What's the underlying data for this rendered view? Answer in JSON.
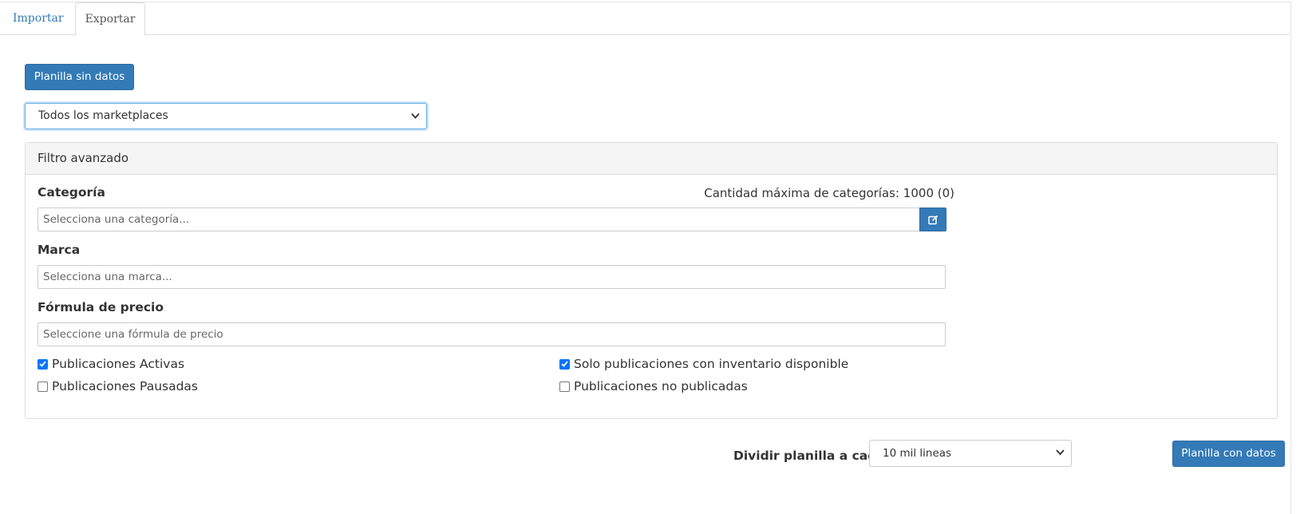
{
  "tabs": [
    {
      "label": "Importar",
      "active": false
    },
    {
      "label": "Exportar",
      "active": true
    }
  ],
  "toolbar": {
    "empty_template_label": "Planilla sin datos"
  },
  "marketplace_select": {
    "selected": "Todos los marketplaces"
  },
  "advanced_filter": {
    "title": "Filtro avanzado",
    "category": {
      "label": "Categoría",
      "max_hint": "Cantidad máxima de categorías: 1000 (0)",
      "placeholder": "Selecciona una categoría...",
      "edit_icon": "edit-icon"
    },
    "brand": {
      "label": "Marca",
      "placeholder": "Selecciona una marca..."
    },
    "price_formula": {
      "label": "Fórmula de precio",
      "placeholder": "Seleccione una fórmula de precio"
    },
    "checkboxes": [
      {
        "label": "Publicaciones Activas",
        "checked": true
      },
      {
        "label": "Solo publicaciones con inventario disponible",
        "checked": true
      },
      {
        "label": "Publicaciones Pausadas",
        "checked": false
      },
      {
        "label": "Publicaciones no publicadas",
        "checked": false
      }
    ]
  },
  "footer": {
    "split_label": "Dividir planilla a cada",
    "split_selected": "10 mil lineas",
    "data_template_label": "Planilla con datos"
  },
  "colors": {
    "primary": "#337ab7",
    "checkbox": "#0075ff",
    "focus": "#66afe9"
  }
}
